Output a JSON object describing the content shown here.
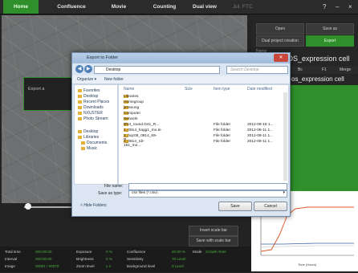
{
  "topbar": {
    "tabs": [
      {
        "label": "Home",
        "active": true
      },
      {
        "label": "Confluence",
        "active": false
      },
      {
        "label": "Movie",
        "active": false
      },
      {
        "label": "Counting",
        "active": false
      },
      {
        "label": "Dual view",
        "active": false
      }
    ],
    "title": "Jul. FTC",
    "help": "?",
    "minimize": "–",
    "close": "×"
  },
  "left_panel": {
    "export_label": "Export a"
  },
  "right_panel": {
    "open_label": "Open",
    "save_as_label": "Save as",
    "dual_project_label": "Dual project creation",
    "export_label": "Export",
    "name_label": "Name",
    "title_line1": "OS_expression cell",
    "title_line2": "os_expression cell",
    "tabs": [
      "Bc",
      "F1",
      "Merge"
    ]
  },
  "bottom_buttons": {
    "insert_scale": "Insert scale bar",
    "save_scale": "Save with scale bar"
  },
  "status": {
    "rows": [
      {
        "l1": "Total time",
        "v1": "000:00:00",
        "l2": "Exposure",
        "v2": "0 %",
        "l3": "Confluence",
        "v3": "20.00 %"
      },
      {
        "l1": "Interval",
        "v1": "000:00:00",
        "l2": "Brightness",
        "v2": "0 %",
        "l3": "Sensitivity",
        "v3": "70 Level"
      },
      {
        "l1": "Image",
        "v1": "00001 / 00070",
        "l2": "Zoom level",
        "v2": "x 1",
        "l3": "Background level",
        "v3": "0 Level"
      }
    ],
    "mode_label": "Mode",
    "mode_value": "Growth Rate"
  },
  "graph": {
    "x_label": "Time (Hours)"
  },
  "dialog": {
    "title": "Export to Folder",
    "address": "Desktop",
    "search_placeholder": "Search Desktop",
    "toolbar": [
      "Organize ▾",
      "New folder"
    ],
    "nav_items": [
      "Favorites",
      "Desktop",
      "Recent Places",
      "Downloads",
      "NXUSTER",
      "Photo Stream",
      "Desktop",
      "Libraries",
      "Documents",
      "Music"
    ],
    "columns": [
      "Name",
      "Size",
      "Item type",
      "Date modified"
    ],
    "files": [
      {
        "name": "Libraries",
        "size": "",
        "type": "",
        "date": ""
      },
      {
        "name": "Homegroup",
        "size": "",
        "type": "",
        "date": ""
      },
      {
        "name": "jimseong",
        "size": "",
        "type": "",
        "date": ""
      },
      {
        "name": "Computer",
        "size": "",
        "type": "",
        "date": ""
      },
      {
        "name": "Network",
        "size": "",
        "type": "",
        "date": ""
      },
      {
        "name": "Ø14_round.D41_R...",
        "size": "",
        "type": "File folder",
        "date": "2012-08-18 1..."
      },
      {
        "name": "1_0914_hagg1_mo.te",
        "size": "",
        "type": "File folder",
        "date": "2012-08-11 1..."
      },
      {
        "name": "2_hqc08_0814_69-R",
        "size": "",
        "type": "File folder",
        "date": "2012-08-11 1..."
      },
      {
        "name": "3_0814_rdr-161_mo...",
        "size": "",
        "type": "File folder",
        "date": "2012-08-11 1..."
      }
    ],
    "filename_label": "File name:",
    "filename_value": "",
    "savetype_label": "Save as type:",
    "savetype_value": "csv files (*.csv)",
    "hide_folders": "Hide Folders",
    "save_button": "Save",
    "cancel_button": "Cancel"
  },
  "colors": {
    "accent_green": "#2f8f2a",
    "status_green": "#49b03c"
  }
}
